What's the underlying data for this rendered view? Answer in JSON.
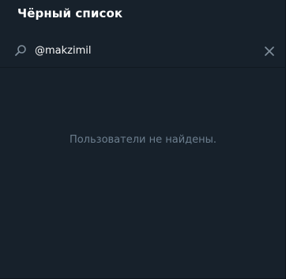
{
  "window": {
    "title": "Чёрный список"
  },
  "search": {
    "value": "@makzimil",
    "icon": "search-icon",
    "clear_icon": "close-icon"
  },
  "results": {
    "empty_message": "Пользователи не найдены."
  },
  "colors": {
    "background": "#17212b",
    "title_text": "#ffffff",
    "input_text": "#f5f5f5",
    "muted_text": "#6d7f8f",
    "icon": "#7f8e9b"
  }
}
